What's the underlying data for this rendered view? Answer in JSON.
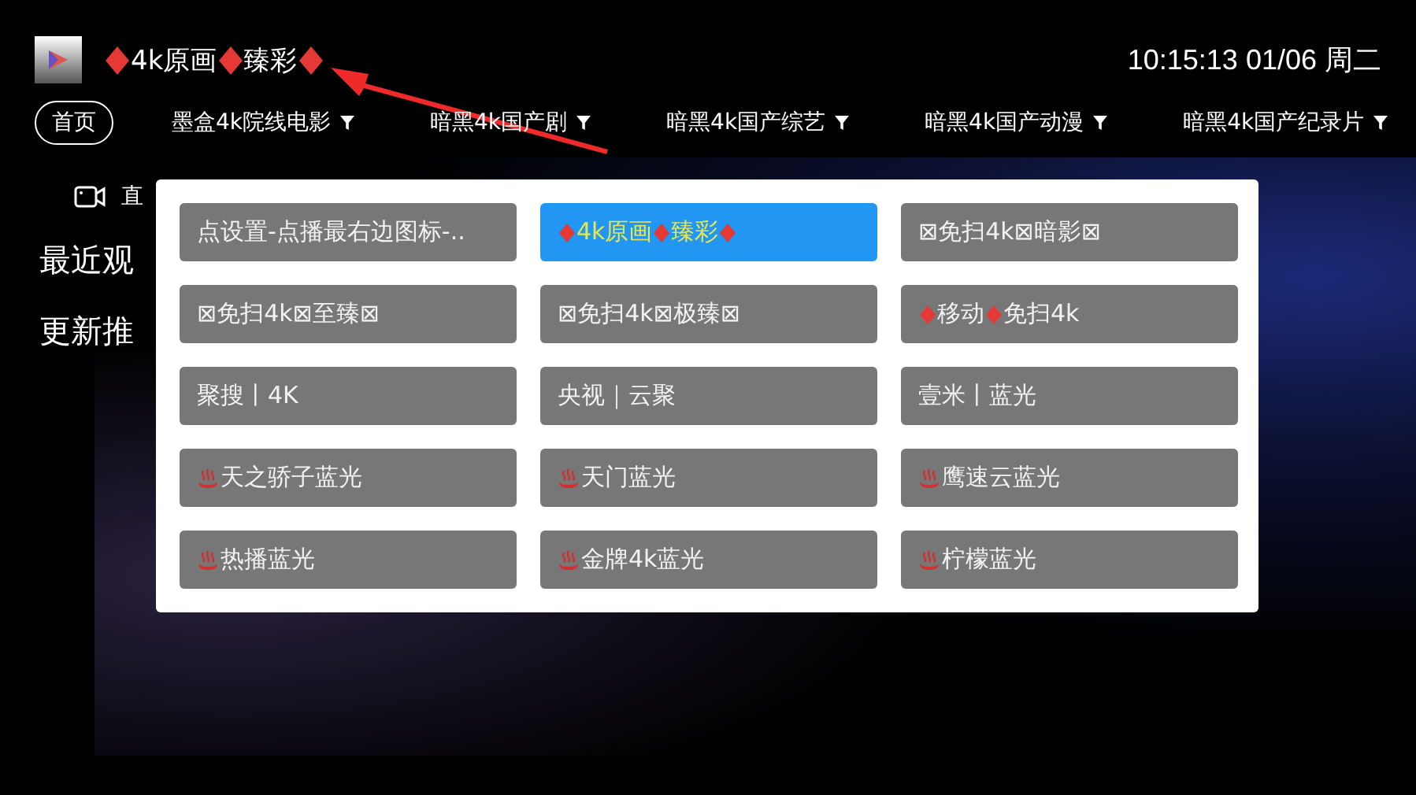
{
  "header": {
    "title_parts": [
      {
        "kind": "diamond"
      },
      {
        "kind": "text",
        "text": "4k原画"
      },
      {
        "kind": "diamond"
      },
      {
        "kind": "text",
        "text": "臻彩"
      },
      {
        "kind": "diamond"
      }
    ],
    "clock": "10:15:13 01/06 周二"
  },
  "tabs": [
    {
      "label": "首页",
      "selected": true,
      "filter": false
    },
    {
      "label": "墨盒4k院线电影",
      "selected": false,
      "filter": true
    },
    {
      "label": "暗黑4k国产剧",
      "selected": false,
      "filter": true
    },
    {
      "label": "暗黑4k国产综艺",
      "selected": false,
      "filter": true
    },
    {
      "label": "暗黑4k国产动漫",
      "selected": false,
      "filter": true
    },
    {
      "label": "暗黑4k国产纪录片",
      "selected": false,
      "filter": true
    }
  ],
  "background": {
    "live_label": "直",
    "sections": [
      "最近观",
      "更新推"
    ]
  },
  "source_menu": {
    "items": [
      {
        "selected": false,
        "parts": [
          {
            "kind": "text",
            "text": "点设置-点播最右边图标-.."
          }
        ]
      },
      {
        "selected": true,
        "parts": [
          {
            "kind": "diamond"
          },
          {
            "kind": "text",
            "text": "4k原画"
          },
          {
            "kind": "diamond"
          },
          {
            "kind": "text",
            "text": "臻彩"
          },
          {
            "kind": "diamond"
          }
        ]
      },
      {
        "selected": false,
        "parts": [
          {
            "kind": "text",
            "text": "⊠免扫4k⊠暗影⊠"
          }
        ]
      },
      {
        "selected": false,
        "parts": [
          {
            "kind": "text",
            "text": "⊠免扫4k⊠至臻⊠"
          }
        ]
      },
      {
        "selected": false,
        "parts": [
          {
            "kind": "text",
            "text": "⊠免扫4k⊠极臻⊠"
          }
        ]
      },
      {
        "selected": false,
        "parts": [
          {
            "kind": "diamond"
          },
          {
            "kind": "text",
            "text": "移动"
          },
          {
            "kind": "diamond"
          },
          {
            "kind": "text",
            "text": "免扫4k"
          }
        ]
      },
      {
        "selected": false,
        "parts": [
          {
            "kind": "text",
            "text": "聚搜丨4K"
          }
        ]
      },
      {
        "selected": false,
        "parts": [
          {
            "kind": "text",
            "text": "央视｜云聚"
          }
        ]
      },
      {
        "selected": false,
        "parts": [
          {
            "kind": "text",
            "text": "壹米丨蓝光"
          }
        ]
      },
      {
        "selected": false,
        "parts": [
          {
            "kind": "hot"
          },
          {
            "kind": "text",
            "text": "天之骄子蓝光"
          }
        ]
      },
      {
        "selected": false,
        "parts": [
          {
            "kind": "hot"
          },
          {
            "kind": "text",
            "text": "天门蓝光"
          }
        ]
      },
      {
        "selected": false,
        "parts": [
          {
            "kind": "hot"
          },
          {
            "kind": "text",
            "text": "鹰速云蓝光"
          }
        ]
      },
      {
        "selected": false,
        "parts": [
          {
            "kind": "hot"
          },
          {
            "kind": "text",
            "text": "热播蓝光"
          }
        ]
      },
      {
        "selected": false,
        "parts": [
          {
            "kind": "hot"
          },
          {
            "kind": "text",
            "text": "金牌4k蓝光"
          }
        ]
      },
      {
        "selected": false,
        "parts": [
          {
            "kind": "hot"
          },
          {
            "kind": "text",
            "text": "柠檬蓝光"
          }
        ]
      }
    ]
  }
}
